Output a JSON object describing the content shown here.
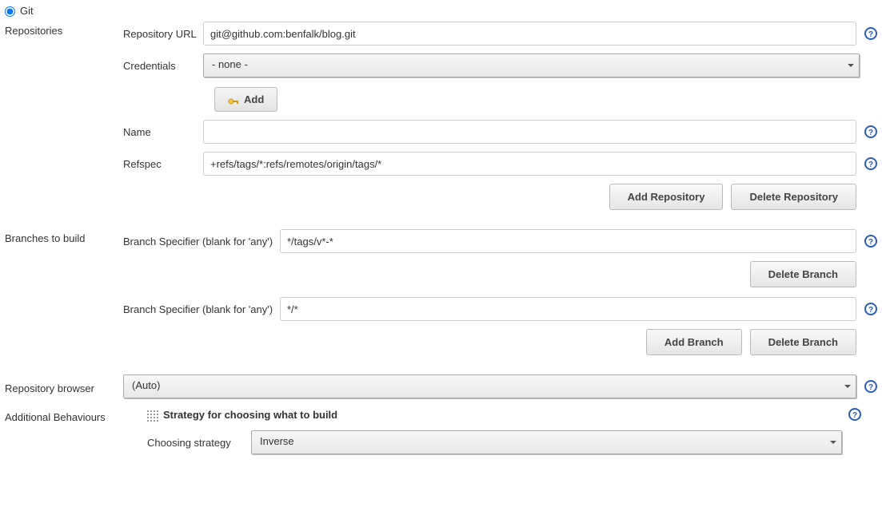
{
  "scm": {
    "radio_label": "Git"
  },
  "repositories": {
    "section_label": "Repositories",
    "url_label": "Repository URL",
    "url_value": "git@github.com:benfalk/blog.git",
    "credentials_label": "Credentials",
    "credentials_value": "- none -",
    "add_label": "Add",
    "name_label": "Name",
    "name_value": "",
    "refspec_label": "Refspec",
    "refspec_value": "+refs/tags/*:refs/remotes/origin/tags/*",
    "add_repo_btn": "Add Repository",
    "delete_repo_btn": "Delete Repository"
  },
  "branches": {
    "section_label": "Branches to build",
    "specifier_label": "Branch Specifier (blank for 'any')",
    "branch1_value": "*/tags/v*-*",
    "branch2_value": "*/*",
    "delete_branch_btn": "Delete Branch",
    "add_branch_btn": "Add Branch"
  },
  "repo_browser": {
    "section_label": "Repository browser",
    "value": "(Auto)"
  },
  "behaviours": {
    "section_label": "Additional Behaviours",
    "strategy_title": "Strategy for choosing what to build",
    "choosing_label": "Choosing strategy",
    "choosing_value": "Inverse"
  }
}
